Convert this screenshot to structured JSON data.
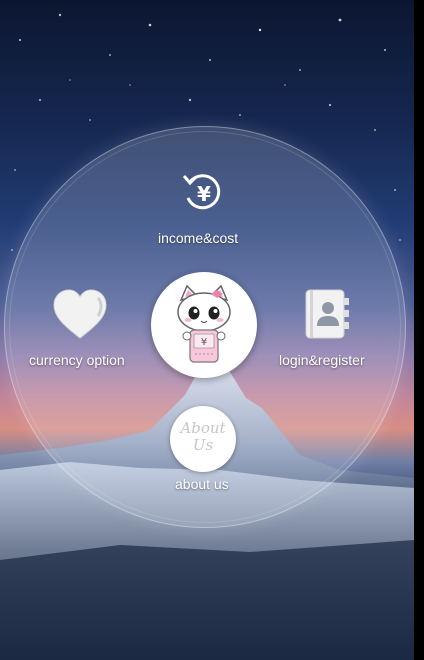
{
  "menu": {
    "items": [
      {
        "id": "income",
        "label": "income&cost",
        "icon": "yuan-refresh-icon"
      },
      {
        "id": "currency",
        "label": "currency option",
        "icon": "heart-icon"
      },
      {
        "id": "login",
        "label": "login&register",
        "icon": "contacts-book-icon"
      },
      {
        "id": "about",
        "label": "about us",
        "icon": "about-us-icon",
        "badge_text": "About Us"
      }
    ],
    "center": {
      "icon": "cat-mascot-icon",
      "coin_symbol": "¥"
    }
  },
  "colors": {
    "label": "#ffffff",
    "circle_fill": "rgba(235,240,255,0.20)",
    "button": "#ffffff"
  }
}
